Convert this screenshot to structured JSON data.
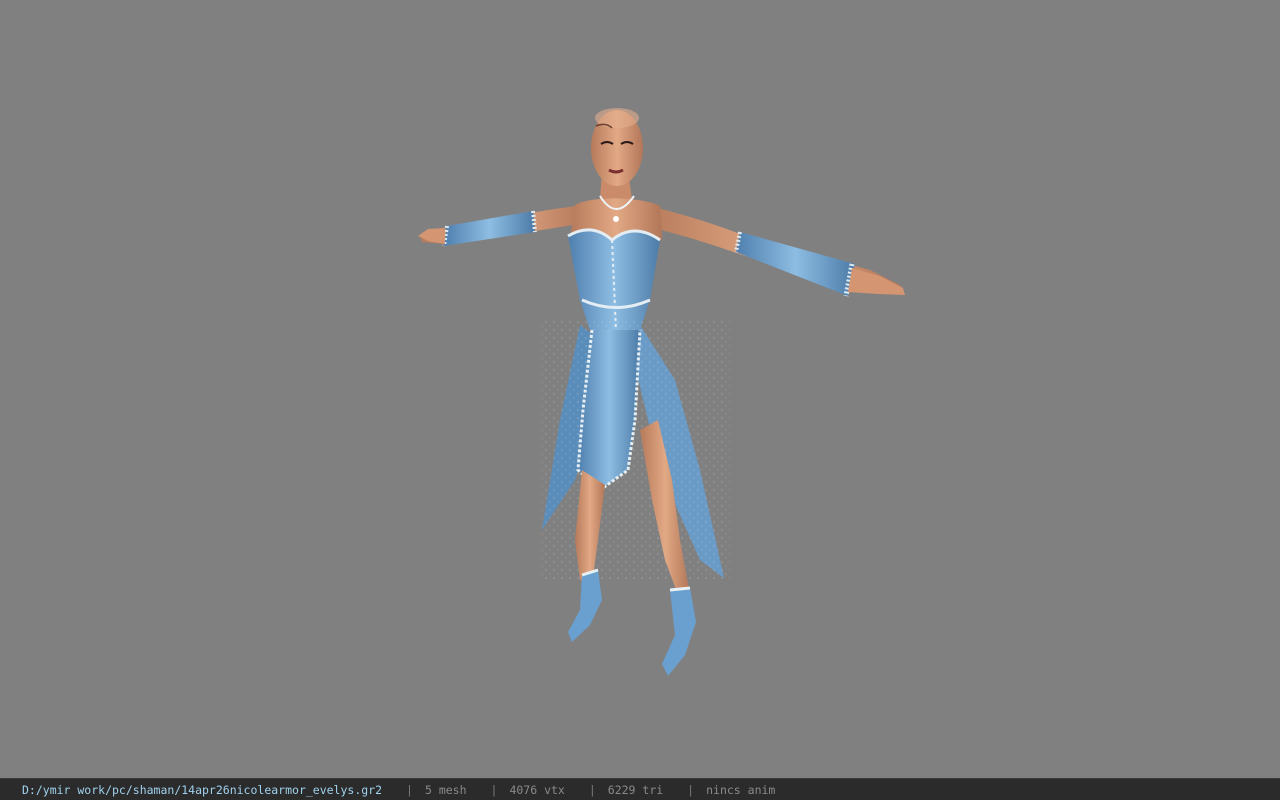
{
  "window": {
    "title": ""
  },
  "viewport": {
    "background_color": "#808080",
    "model": {
      "description_icon": "character-model",
      "outfit_color": "#6fa4d2",
      "trim_color": "#d9e6ee",
      "skin_color": "#d79a76"
    }
  },
  "statusbar": {
    "file_path": "D:/ymir work/pc/shaman/14apr26nicolearmor_evelys.gr2",
    "separator": "|",
    "mesh_count": "5 mesh",
    "vertex_count": "4076 vtx",
    "triangle_count": "6229 tri",
    "anim_status": "nincs anim",
    "path_color": "#9fd2ee"
  }
}
